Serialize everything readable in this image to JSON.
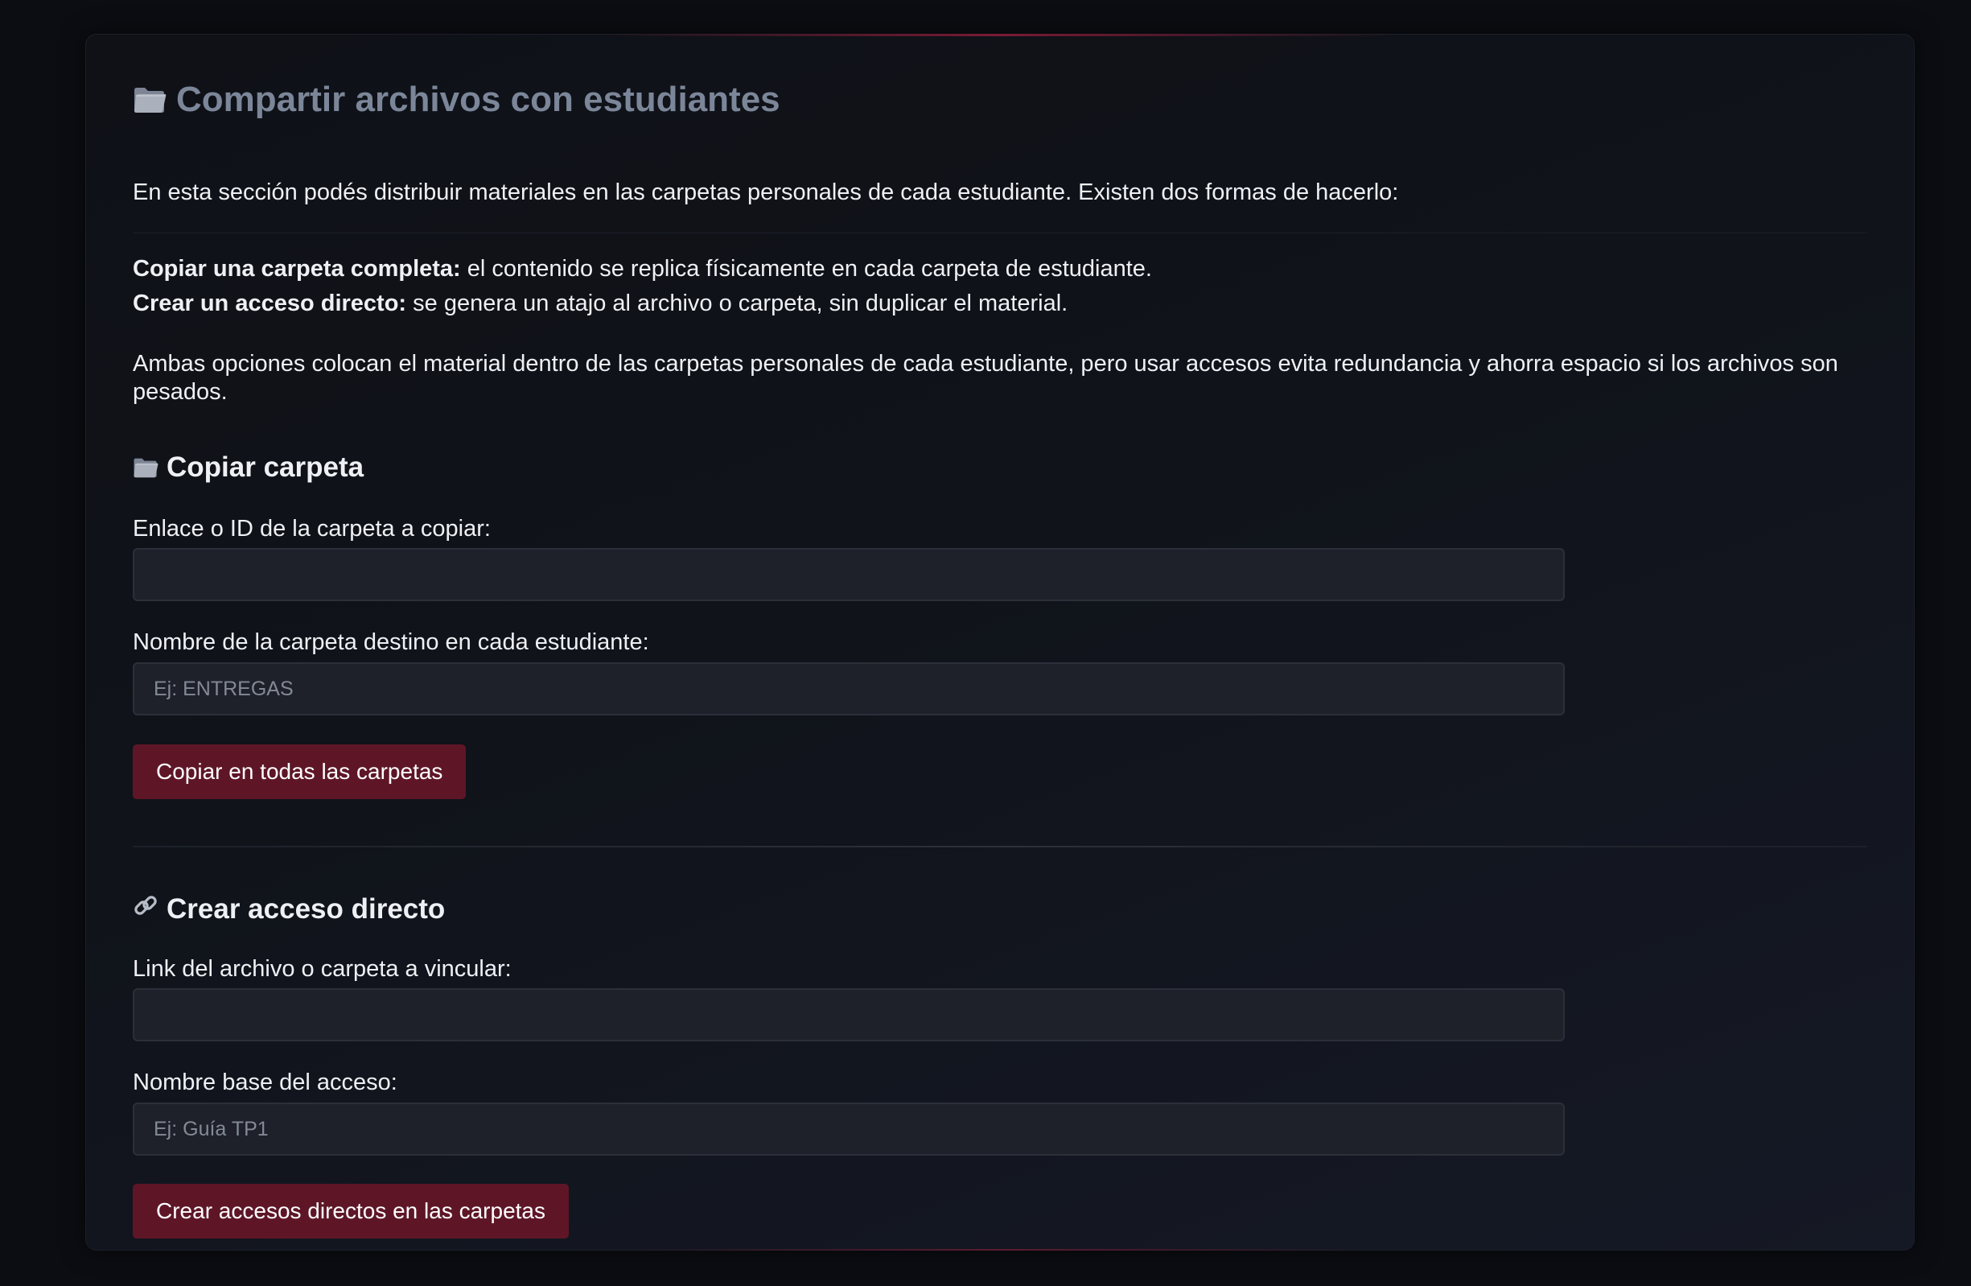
{
  "header": {
    "title": "Compartir archivos con estudiantes",
    "title_icon": "folder-icon"
  },
  "intro": {
    "text": "En esta sección podés distribuir materiales en las carpetas personales de cada estudiante. Existen dos formas de hacerlo:",
    "option_copy_bold": "Copiar una carpeta completa:",
    "option_copy_text": " el contenido se replica físicamente en cada carpeta de estudiante.",
    "option_shortcut_bold": "Crear un acceso directo:",
    "option_shortcut_text": " se genera un atajo al archivo o carpeta, sin duplicar el material.",
    "paragraph": "Ambas opciones colocan el material dentro de las carpetas personales de cada estudiante, pero usar accesos evita redundancia y ahorra espacio si los archivos son pesados."
  },
  "copy_section": {
    "title": "Copiar carpeta",
    "icon": "folder-icon",
    "source_label": "Enlace o ID de la carpeta a copiar:",
    "source_value": "",
    "source_placeholder": "",
    "dest_label": "Nombre de la carpeta destino en cada estudiante:",
    "dest_value": "",
    "dest_placeholder": "Ej: ENTREGAS",
    "button_label": "Copiar en todas las carpetas"
  },
  "shortcut_section": {
    "title": "Crear acceso directo",
    "icon": "link-icon",
    "link_label": "Link del archivo o carpeta a vincular:",
    "link_value": "",
    "link_placeholder": "",
    "name_label": "Nombre base del acceso:",
    "name_value": "",
    "name_placeholder": "Ej: Guía TP1",
    "button_label": "Crear accesos directos en las carpetas"
  },
  "colors": {
    "background": "#0b0d12",
    "card": "#10131a",
    "title_muted": "#7b8699",
    "button": "#5e1627",
    "accent_glow": "#7a1a34",
    "input_bg": "#1e2129"
  }
}
